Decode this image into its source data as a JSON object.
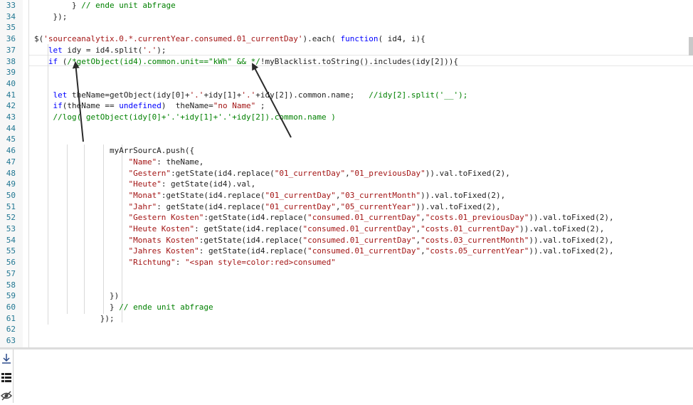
{
  "editor": {
    "lines": [
      {
        "num": "33",
        "text": "        } // ende unit abfrage"
      },
      {
        "num": "34",
        "text": "    });"
      },
      {
        "num": "35",
        "text": ""
      },
      {
        "num": "36",
        "text": "$('sourceanalytix.0.*.currentYear.consumed.01_currentDay').each( function( id4, i){"
      },
      {
        "num": "37",
        "text": "   let idy = id4.split('.');"
      },
      {
        "num": "38",
        "text": "   if (/*getObject(id4).common.unit==\"kWh\" && */!myBlacklist.toString().includes(idy[2])){"
      },
      {
        "num": "39",
        "text": ""
      },
      {
        "num": "40",
        "text": ""
      },
      {
        "num": "41",
        "text": "    let theName=getObject(idy[0]+'.'+idy[1]+'.'+idy[2]).common.name;   //idy[2].split('__');"
      },
      {
        "num": "42",
        "text": "    if(theName == undefined)  theName=\"no Name\" ;"
      },
      {
        "num": "43",
        "text": "    //log( getObject(idy[0]+'.'+idy[1]+'.'+idy[2]).common.name )"
      },
      {
        "num": "44",
        "text": ""
      },
      {
        "num": "45",
        "text": ""
      },
      {
        "num": "46",
        "text": "                myArrSourcA.push({"
      },
      {
        "num": "47",
        "text": "                    \"Name\": theName,"
      },
      {
        "num": "48",
        "text": "                    \"Gestern\":getState(id4.replace(\"01_currentDay\",\"01_previousDay\")).val.toFixed(2),"
      },
      {
        "num": "49",
        "text": "                    \"Heute\": getState(id4).val,"
      },
      {
        "num": "50",
        "text": "                    \"Monat\":getState(id4.replace(\"01_currentDay\",\"03_currentMonth\")).val.toFixed(2),"
      },
      {
        "num": "51",
        "text": "                    \"Jahr\": getState(id4.replace(\"01_currentDay\",\"05_currentYear\")).val.toFixed(2),"
      },
      {
        "num": "52",
        "text": "                    \"Gestern Kosten\":getState(id4.replace(\"consumed.01_currentDay\",\"costs.01_previousDay\")).val.toFixed(2),"
      },
      {
        "num": "53",
        "text": "                    \"Heute Kosten\": getState(id4.replace(\"consumed.01_currentDay\",\"costs.01_currentDay\")).val.toFixed(2),"
      },
      {
        "num": "54",
        "text": "                    \"Monats Kosten\":getState(id4.replace(\"consumed.01_currentDay\",\"costs.03_currentMonth\")).val.toFixed(2),"
      },
      {
        "num": "55",
        "text": "                    \"Jahres Kosten\": getState(id4.replace(\"consumed.01_currentDay\",\"costs.05_currentYear\")).val.toFixed(2),"
      },
      {
        "num": "56",
        "text": "                    \"Richtung\": \"<span style=color:red>consumed\""
      },
      {
        "num": "57",
        "text": ""
      },
      {
        "num": "58",
        "text": ""
      },
      {
        "num": "59",
        "text": "                })"
      },
      {
        "num": "60",
        "text": "                } // ende unit abfrage"
      },
      {
        "num": "61",
        "text": "              });"
      },
      {
        "num": "62",
        "text": ""
      },
      {
        "num": "63",
        "text": ""
      }
    ]
  },
  "toolbar": {
    "icons": [
      "download-icon",
      "list-icon",
      "eye-off-icon"
    ]
  },
  "colors": {
    "keyword": "#0000ff",
    "string": "#a31515",
    "comment": "#008000",
    "line_number": "#237893",
    "annotation_arrow": "#2b2b2b"
  }
}
